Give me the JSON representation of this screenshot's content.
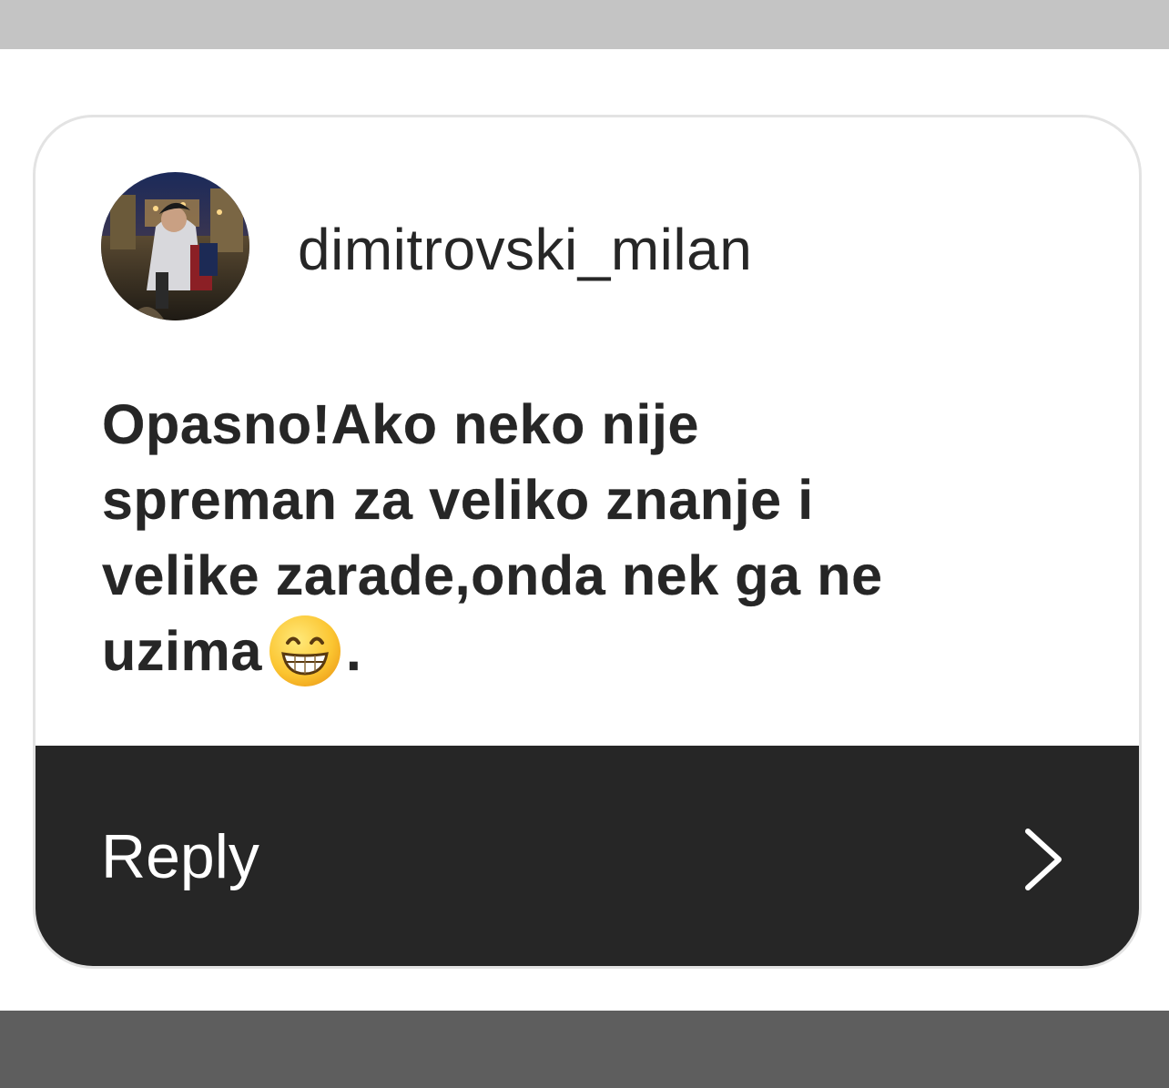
{
  "comment_card": {
    "username": "dimitrovski_milan",
    "avatar_alt": "profile-photo",
    "comment_lines": [
      "Opasno!Ako neko nije",
      "spreman za veliko znanje i",
      "velike zarade,onda nek ga ne",
      "uzima"
    ],
    "comment_suffix": ".",
    "emoji_icon": "grinning-face-with-smiling-eyes",
    "reply_label": "Reply",
    "chevron_icon": "chevron-right-icon"
  },
  "colors": {
    "top_band": "#c4c4c4",
    "bottom_band": "#5e5e5e",
    "card_border": "#e3e3e3",
    "text": "#262626",
    "reply_bar": "#262626",
    "reply_text": "#ffffff"
  }
}
